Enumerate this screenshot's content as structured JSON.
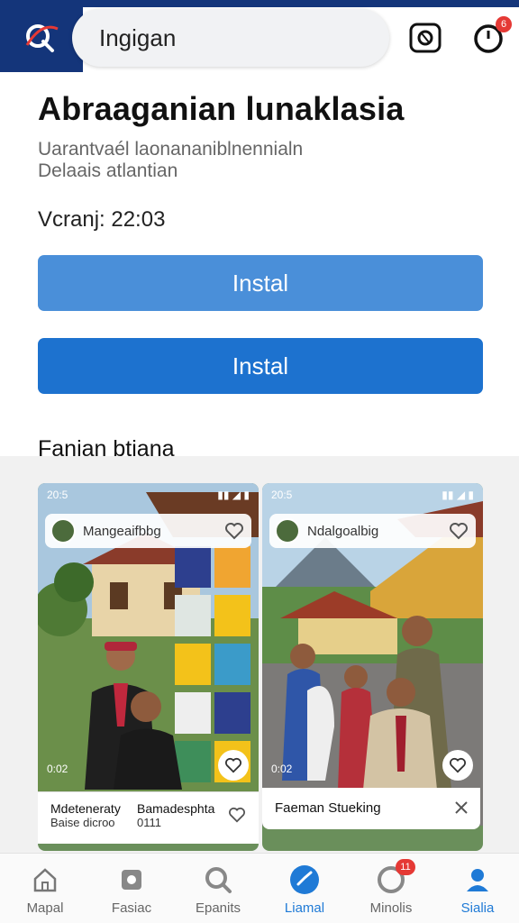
{
  "header": {
    "search_text": "Ingigan",
    "notification_count": "6",
    "logo_icon": "app-logo-icon",
    "camera_icon": "lens-icon",
    "notify_icon": "alarm-icon"
  },
  "app": {
    "title": "Abraaganian lunaklasia",
    "description_line1": "Uarantvaél laonananiblnennialn",
    "description_line2": "Delaais atlantian",
    "version": "Vcranj: 22:03",
    "install_label_1": "Instal",
    "install_label_2": "Instal"
  },
  "gallery": {
    "title": "Fanian btiana",
    "cards": [
      {
        "status_time": "20:5",
        "account": "Mangeaifbbg",
        "overlay": "0:02",
        "caption_col1_line1": "Mdeteneraty",
        "caption_col1_line2": "Baise dicroo",
        "caption_col2_line1": "Bamadesphta",
        "caption_col2_line2": "0111"
      },
      {
        "status_time": "20:5",
        "account": "Ndalgoalbig",
        "overlay": "0:02",
        "caption": "Faeman Stueking"
      }
    ]
  },
  "nav": {
    "items": [
      {
        "label": "Mapal",
        "icon": "home-icon"
      },
      {
        "label": "Fasiac",
        "icon": "store-icon"
      },
      {
        "label": "Epanits",
        "icon": "search-icon"
      },
      {
        "label": "Liamal",
        "icon": "library-icon"
      },
      {
        "label": "Minolis",
        "icon": "notifications-icon",
        "badge": "11"
      },
      {
        "label": "Sialia",
        "icon": "profile-icon"
      }
    ],
    "active": "Liamal"
  },
  "colors": {
    "brand_navy": "#14357a",
    "button_light": "#4a8fd9",
    "button_dark": "#1d72cf",
    "active": "#1f7ad6",
    "badge": "#e53935"
  }
}
